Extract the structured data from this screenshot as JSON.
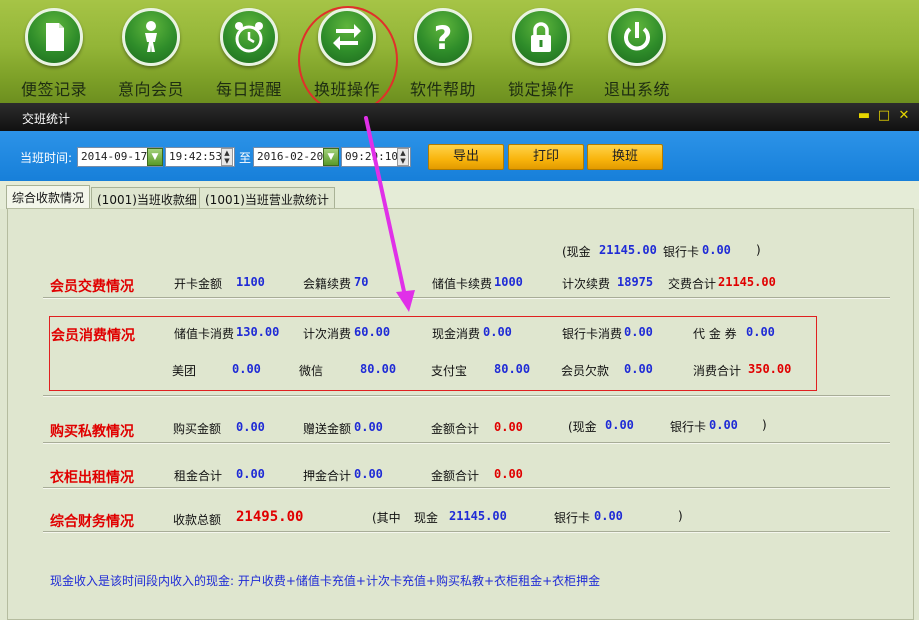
{
  "toolbar": {
    "items": [
      {
        "label": "便签记录",
        "icon": "note-icon"
      },
      {
        "label": "意向会员",
        "icon": "person-icon"
      },
      {
        "label": "每日提醒",
        "icon": "alarm-clock-icon"
      },
      {
        "label": "换班操作",
        "icon": "swap-arrows-icon"
      },
      {
        "label": "软件帮助",
        "icon": "help-icon"
      },
      {
        "label": "锁定操作",
        "icon": "lock-icon"
      },
      {
        "label": "退出系统",
        "icon": "power-icon"
      }
    ]
  },
  "window": {
    "title": "交班统计",
    "minimize": "▬",
    "maximize": "□",
    "close": "✕"
  },
  "filter": {
    "label": "当班时间:",
    "start_date": "2014-09-17",
    "start_time": "19:42:53",
    "to_label": "至",
    "end_date": "2016-02-20",
    "end_time": "09:29:10",
    "export": "导出",
    "print": "打印",
    "shift": "换班"
  },
  "tabs": [
    {
      "label": "综合收款情况",
      "active": true
    },
    {
      "label": "(1001)当班收款细",
      "active": false
    },
    {
      "label": "(1001)当班营业款统计",
      "active": false
    }
  ],
  "summary_top": {
    "open": "(现金",
    "cash": "21145.00",
    "bank_label": "银行卡",
    "bank": "0.00",
    "close": ")"
  },
  "sections": {
    "member_fee": {
      "title": "会员交费情况",
      "card_open_label": "开卡金额",
      "card_open": "1100",
      "renew_label": "会籍续费",
      "renew": "70",
      "stored_label": "储值卡续费",
      "stored": "1000",
      "count_label": "计次续费",
      "count": "18975",
      "total_label": "交费合计",
      "total": "21145.00"
    },
    "member_consume": {
      "title": "会员消费情况",
      "stored_label": "储值卡消费",
      "stored": "130.00",
      "count_label": "计次消费",
      "count": "60.00",
      "cash_label": "现金消费",
      "cash": "0.00",
      "bank_label": "银行卡消费",
      "bank": "0.00",
      "voucher_label": "代 金 券",
      "voucher": "0.00",
      "meituan_label": "美团",
      "meituan": "0.00",
      "wechat_label": "微信",
      "wechat": "80.00",
      "alipay_label": "支付宝",
      "alipay": "80.00",
      "debt_label": "会员欠款",
      "debt": "0.00",
      "total_label": "消费合计",
      "total": "350.00"
    },
    "private_coach": {
      "title": "购买私教情况",
      "buy_label": "购买金额",
      "buy": "0.00",
      "gift_label": "赠送金额",
      "gift": "0.00",
      "total_label": "金额合计",
      "total": "0.00",
      "open": "(现金",
      "cash": "0.00",
      "bank_label": "银行卡",
      "bank": "0.00",
      "close": ")"
    },
    "locker": {
      "title": "衣柜出租情况",
      "rent_label": "租金合计",
      "rent": "0.00",
      "deposit_label": "押金合计",
      "deposit": "0.00",
      "total_label": "金额合计",
      "total": "0.00"
    },
    "finance": {
      "title": "综合财务情况",
      "collected_label": "收款总额",
      "collected": "21495.00",
      "open": "(其中",
      "cash_label": "现金",
      "cash": "21145.00",
      "bank_label": "银行卡",
      "bank": "0.00",
      "close": ")"
    }
  },
  "note": "现金收入是该时间段内收入的现金: 开户收费+储值卡充值+计次卡充值+购买私教+衣柜租金+衣柜押金",
  "colors": {
    "accent_red": "#e00000",
    "value_blue": "#1f2bd6",
    "annotation_magenta": "#e030e8",
    "button_orange": "#f8b40c"
  }
}
